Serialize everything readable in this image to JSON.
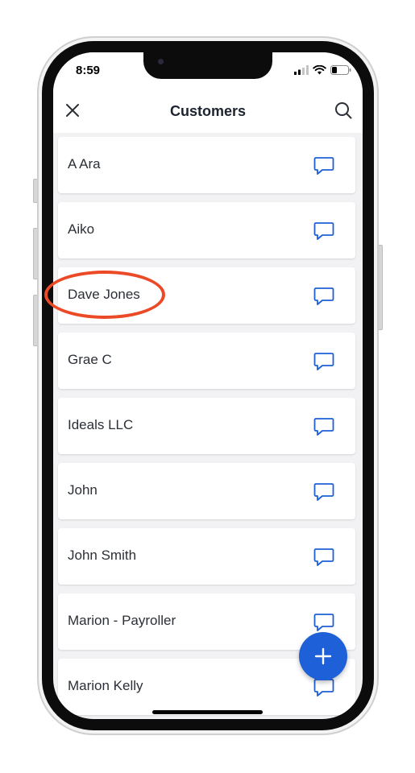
{
  "status_bar": {
    "time": "8:59"
  },
  "header": {
    "title": "Customers"
  },
  "customers": [
    {
      "name": "A Ara"
    },
    {
      "name": "Aiko"
    },
    {
      "name": "Dave Jones"
    },
    {
      "name": "Grae C"
    },
    {
      "name": "Ideals LLC"
    },
    {
      "name": "John"
    },
    {
      "name": "John Smith"
    },
    {
      "name": "Marion - Payroller"
    },
    {
      "name": "Marion Kelly"
    }
  ],
  "icons": {
    "close": "close-icon",
    "search": "search-icon",
    "message": "chat-bubble-icon",
    "add": "plus-icon"
  },
  "colors": {
    "accent": "#1d60d8",
    "annotation": "#ec4a27",
    "text": "#2b2f36",
    "list_background": "#f2f2f4"
  },
  "annotation": {
    "highlighted_item": "Dave Jones"
  }
}
